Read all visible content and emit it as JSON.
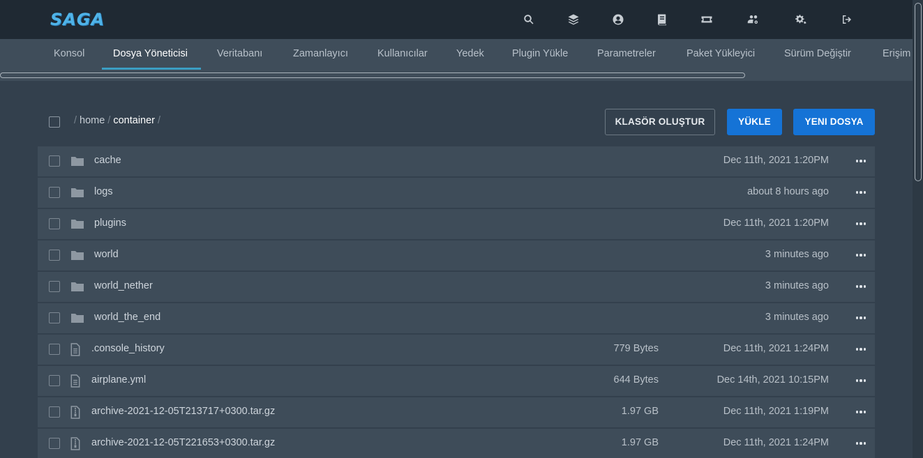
{
  "app": {
    "logo_text": "SAGA",
    "logo_color": "#4fb3e8"
  },
  "top_icons": [
    {
      "name": "search-icon"
    },
    {
      "name": "layers-icon"
    },
    {
      "name": "account-icon"
    },
    {
      "name": "book-icon"
    },
    {
      "name": "ticket-icon"
    },
    {
      "name": "users-cog-icon"
    },
    {
      "name": "cogs-icon"
    },
    {
      "name": "sign-out-icon"
    }
  ],
  "nav": {
    "tabs": [
      {
        "label": "Konsol",
        "active": false
      },
      {
        "label": "Dosya Yöneticisi",
        "active": true
      },
      {
        "label": "Veritabanı",
        "active": false
      },
      {
        "label": "Zamanlayıcı",
        "active": false
      },
      {
        "label": "Kullanıcılar",
        "active": false
      },
      {
        "label": "Yedek",
        "active": false
      },
      {
        "label": "Plugin Yükle",
        "active": false
      },
      {
        "label": "Parametreler",
        "active": false
      },
      {
        "label": "Paket Yükleyici",
        "active": false
      },
      {
        "label": "Sürüm Değiştir",
        "active": false
      },
      {
        "label": "Erişim",
        "active": false
      }
    ],
    "accent_color": "#3b9ec4"
  },
  "breadcrumb": {
    "parts": [
      "home"
    ],
    "current": "container"
  },
  "toolbar": {
    "create_folder_label": "KLASÖR OLUŞTUR",
    "upload_label": "YÜKLE",
    "new_file_label": "YENI DOSYA",
    "primary_color": "#1573d6"
  },
  "files": [
    {
      "name": "cache",
      "type": "folder",
      "size": "",
      "date": "Dec 11th, 2021 1:20PM"
    },
    {
      "name": "logs",
      "type": "folder",
      "size": "",
      "date": "about 8 hours ago"
    },
    {
      "name": "plugins",
      "type": "folder",
      "size": "",
      "date": "Dec 11th, 2021 1:20PM"
    },
    {
      "name": "world",
      "type": "folder",
      "size": "",
      "date": "3 minutes ago"
    },
    {
      "name": "world_nether",
      "type": "folder",
      "size": "",
      "date": "3 minutes ago"
    },
    {
      "name": "world_the_end",
      "type": "folder",
      "size": "",
      "date": "3 minutes ago"
    },
    {
      "name": ".console_history",
      "type": "file",
      "size": "779 Bytes",
      "date": "Dec 11th, 2021 1:24PM"
    },
    {
      "name": "airplane.yml",
      "type": "file",
      "size": "644 Bytes",
      "date": "Dec 14th, 2021 10:15PM"
    },
    {
      "name": "archive-2021-12-05T213717+0300.tar.gz",
      "type": "archive",
      "size": "1.97 GB",
      "date": "Dec 11th, 2021 1:19PM"
    },
    {
      "name": "archive-2021-12-05T221653+0300.tar.gz",
      "type": "archive",
      "size": "1.97 GB",
      "date": "Dec 11th, 2021 1:24PM"
    }
  ]
}
